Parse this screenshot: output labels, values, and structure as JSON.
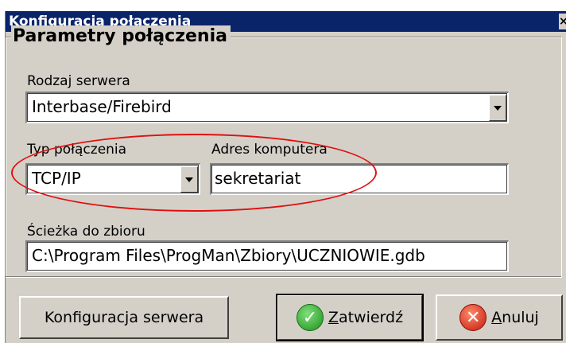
{
  "window": {
    "title": "Konfiguracja połączenia",
    "close_glyph": "×"
  },
  "group": {
    "legend": "Parametry połączenia"
  },
  "server_type": {
    "label": "Rodzaj serwera",
    "value": "Interbase/Firebird"
  },
  "connection_type": {
    "label": "Typ połączenia",
    "value": "TCP/IP"
  },
  "computer_address": {
    "label": "Adres komputera",
    "value": "sekretariat"
  },
  "db_path": {
    "label": "Ścieżka do zbioru",
    "value": "C:\\Program Files\\ProgMan\\Zbiory\\UCZNIOWIE.gdb"
  },
  "buttons": {
    "server_config": "Konfiguracja serwera",
    "confirm_underline": "Z",
    "confirm_rest": "atwierdź",
    "cancel_underline": "A",
    "cancel_rest": "nuluj"
  },
  "icons": {
    "confirm": "check-icon",
    "cancel": "x-icon"
  },
  "colors": {
    "titlebar": "#0a246a",
    "face": "#d4d0c8",
    "highlight_ellipse": "#e01010"
  }
}
